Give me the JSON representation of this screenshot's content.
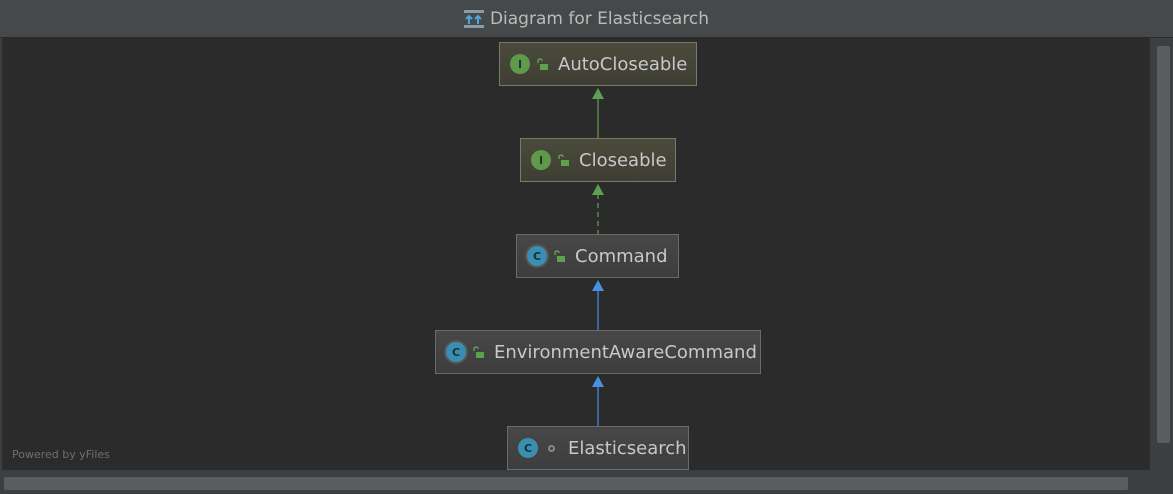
{
  "window": {
    "title": "Diagram for Elasticsearch"
  },
  "nodes": [
    {
      "name": "AutoCloseable",
      "kind": "interface",
      "badge": "I"
    },
    {
      "name": "Closeable",
      "kind": "interface",
      "badge": "I"
    },
    {
      "name": "Command",
      "kind": "abstract-class",
      "badge": "C"
    },
    {
      "name": "EnvironmentAwareCommand",
      "kind": "abstract-class",
      "badge": "C"
    },
    {
      "name": "Elasticsearch",
      "kind": "class",
      "badge": "C"
    }
  ],
  "edges": [
    {
      "from": "Closeable",
      "to": "AutoCloseable",
      "type": "extends",
      "color": "#5fa04e"
    },
    {
      "from": "Command",
      "to": "Closeable",
      "type": "implements",
      "color": "#5fa04e"
    },
    {
      "from": "EnvironmentAwareCommand",
      "to": "Command",
      "type": "extends",
      "color": "#4a90e2"
    },
    {
      "from": "Elasticsearch",
      "to": "EnvironmentAwareCommand",
      "type": "extends",
      "color": "#4a90e2"
    }
  ],
  "footer": {
    "powered_by": "Powered by yFiles"
  }
}
